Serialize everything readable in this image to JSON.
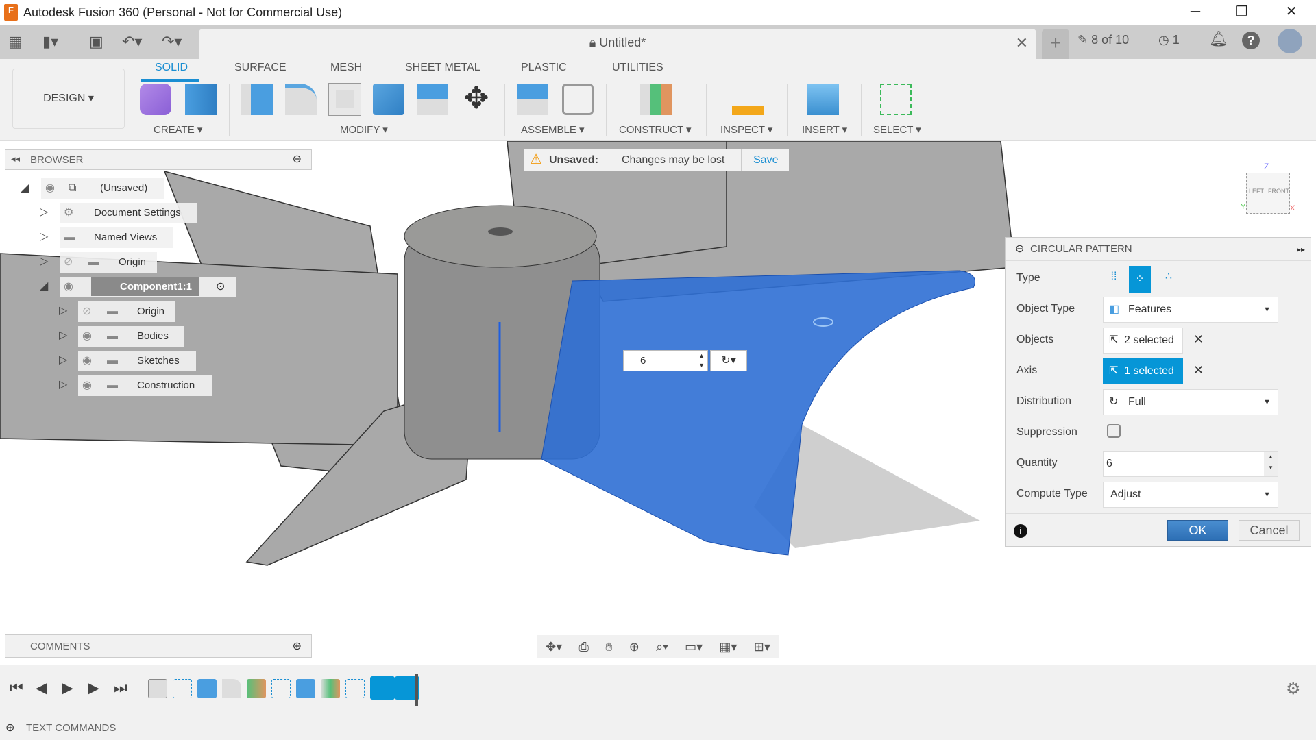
{
  "window": {
    "title": "Autodesk Fusion 360 (Personal - Not for Commercial Use)",
    "logo": "F"
  },
  "toolbar": {
    "doc_title": "Untitled*",
    "jobs": "8 of 10",
    "history_count": "1",
    "icons": [
      "grid-icon",
      "file-icon",
      "save-icon",
      "undo-icon",
      "redo-icon"
    ]
  },
  "workspace": {
    "label": "DESIGN"
  },
  "tabs": [
    {
      "label": "SOLID",
      "active": true
    },
    {
      "label": "SURFACE"
    },
    {
      "label": "MESH"
    },
    {
      "label": "SHEET METAL"
    },
    {
      "label": "PLASTIC"
    },
    {
      "label": "UTILITIES"
    }
  ],
  "groups": [
    "CREATE",
    "MODIFY",
    "ASSEMBLE",
    "CONSTRUCT",
    "INSPECT",
    "INSERT",
    "SELECT"
  ],
  "browser": {
    "title": "BROWSER",
    "items": [
      {
        "label": "(Unsaved)"
      },
      {
        "label": "Document Settings"
      },
      {
        "label": "Named Views"
      },
      {
        "label": "Origin"
      },
      {
        "label": "Component1:1"
      },
      {
        "label": "Origin"
      },
      {
        "label": "Bodies"
      },
      {
        "label": "Sketches"
      },
      {
        "label": "Construction"
      }
    ]
  },
  "banner": {
    "title": "Unsaved:",
    "message": "Changes may be lost",
    "action": "Save"
  },
  "viewcube": {
    "top": "Z",
    "left": "LEFT",
    "front": "FRONT",
    "x": "X",
    "y": "Y"
  },
  "inline_quantity": "6",
  "panel": {
    "title": "CIRCULAR PATTERN",
    "type_label": "Type",
    "object_type_label": "Object Type",
    "object_type_value": "Features",
    "objects_label": "Objects",
    "objects_value": "2 selected",
    "axis_label": "Axis",
    "axis_value": "1 selected",
    "distribution_label": "Distribution",
    "distribution_value": "Full",
    "suppression_label": "Suppression",
    "suppression_checked": false,
    "quantity_label": "Quantity",
    "quantity_value": "6",
    "compute_label": "Compute Type",
    "compute_value": "Adjust",
    "ok": "OK",
    "cancel": "Cancel",
    "accent": "#0696d7"
  },
  "comments": {
    "title": "COMMENTS"
  },
  "text_commands": {
    "title": "TEXT COMMANDS"
  }
}
